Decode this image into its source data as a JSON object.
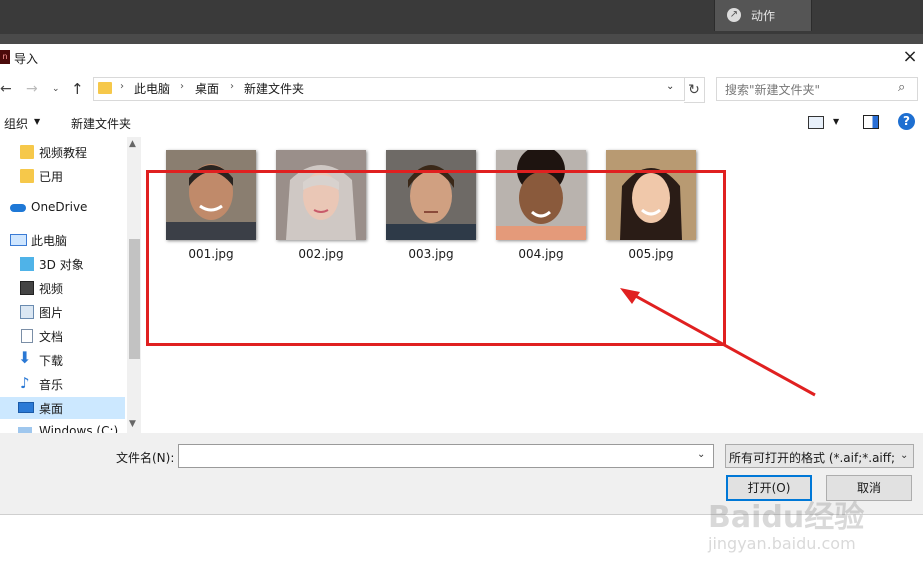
{
  "app": {
    "action_label": "动作"
  },
  "dialog": {
    "title": "导入",
    "breadcrumbs": [
      "此电脑",
      "桌面",
      "新建文件夹"
    ],
    "search_placeholder": "搜索\"新建文件夹\"",
    "toolbar": {
      "organize": "组织",
      "new_folder": "新建文件夹"
    }
  },
  "nav": {
    "items": [
      {
        "label": "视频教程",
        "icon": "folder-icon"
      },
      {
        "label": "已用",
        "icon": "folder-icon"
      },
      {
        "label": "OneDrive",
        "icon": "cloud-icon"
      },
      {
        "label": "此电脑",
        "icon": "computer-icon"
      },
      {
        "label": "3D 对象",
        "icon": "cube-icon"
      },
      {
        "label": "视频",
        "icon": "video-icon"
      },
      {
        "label": "图片",
        "icon": "picture-icon"
      },
      {
        "label": "文档",
        "icon": "document-icon"
      },
      {
        "label": "下载",
        "icon": "download-icon"
      },
      {
        "label": "音乐",
        "icon": "music-icon"
      },
      {
        "label": "桌面",
        "icon": "desktop-icon",
        "selected": true
      },
      {
        "label": "Windows (C:)",
        "icon": "drive-icon"
      }
    ]
  },
  "files": [
    {
      "name": "001.jpg"
    },
    {
      "name": "002.jpg"
    },
    {
      "name": "003.jpg"
    },
    {
      "name": "004.jpg"
    },
    {
      "name": "005.jpg"
    }
  ],
  "bottom": {
    "filename_label": "文件名(N):",
    "filename_value": "",
    "filter": "所有可打开的格式 (*.aif;*.aiff;*",
    "open_button": "打开(O)",
    "cancel_button": "取消"
  },
  "watermark": {
    "main": "Baidu经验",
    "sub": "jingyan.baidu.com"
  },
  "colors": {
    "highlight": "#e02020",
    "selection": "#cce8ff",
    "accent": "#0078d7"
  }
}
